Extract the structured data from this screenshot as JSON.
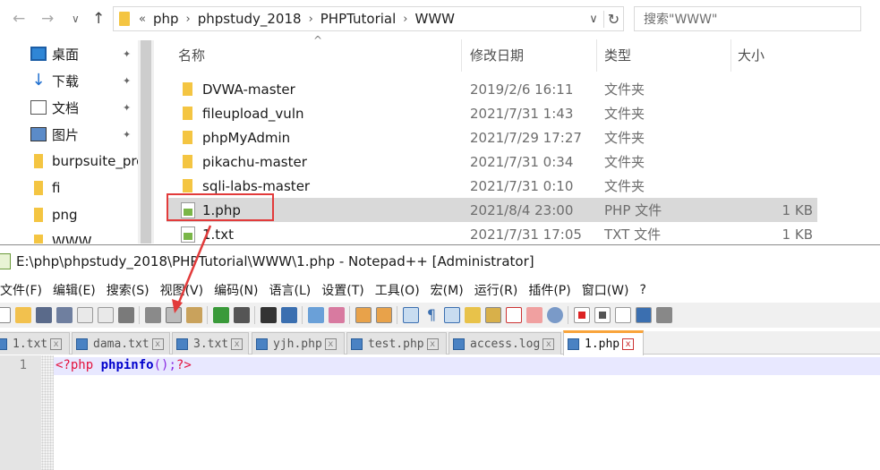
{
  "explorer": {
    "nav_back": "←",
    "nav_forward": "→",
    "nav_down": "∨",
    "nav_up": "↑",
    "address": {
      "overflow": "«",
      "crumbs": [
        "php",
        "phpstudy_2018",
        "PHPTutorial",
        "WWW"
      ],
      "dropdown": "∨",
      "refresh": "↻"
    },
    "search_placeholder": "搜索\"WWW\"",
    "sidebar": [
      {
        "label": "桌面",
        "icon": "desktop-icon",
        "pinned": true
      },
      {
        "label": "下载",
        "icon": "download-icon",
        "pinned": true
      },
      {
        "label": "文档",
        "icon": "document-icon",
        "pinned": true
      },
      {
        "label": "图片",
        "icon": "pictures-icon",
        "pinned": true
      },
      {
        "label": "burpsuite_pro",
        "icon": "folder-icon",
        "pinned": false
      },
      {
        "label": "fi",
        "icon": "folder-icon",
        "pinned": false
      },
      {
        "label": "png",
        "icon": "folder-icon",
        "pinned": false
      },
      {
        "label": "WWW",
        "icon": "folder-icon",
        "pinned": false
      }
    ],
    "pin_glyph": "📌",
    "columns": {
      "name": "名称",
      "date": "修改日期",
      "type": "类型",
      "size": "大小",
      "sort_glyph": "^"
    },
    "files": [
      {
        "name": "DVWA-master",
        "date": "2019/2/6 16:11",
        "type": "文件夹",
        "size": "",
        "kind": "folder",
        "selected": false
      },
      {
        "name": "fileupload_vuln",
        "date": "2021/7/31 1:43",
        "type": "文件夹",
        "size": "",
        "kind": "folder",
        "selected": false
      },
      {
        "name": "phpMyAdmin",
        "date": "2021/7/29 17:27",
        "type": "文件夹",
        "size": "",
        "kind": "folder",
        "selected": false
      },
      {
        "name": "pikachu-master",
        "date": "2021/7/31 0:34",
        "type": "文件夹",
        "size": "",
        "kind": "folder",
        "selected": false
      },
      {
        "name": "sqli-labs-master",
        "date": "2021/7/31 0:10",
        "type": "文件夹",
        "size": "",
        "kind": "folder",
        "selected": false
      },
      {
        "name": "1.php",
        "date": "2021/8/4 23:00",
        "type": "PHP 文件",
        "size": "1 KB",
        "kind": "file",
        "selected": true
      },
      {
        "name": "1.txt",
        "date": "2021/7/31 17:05",
        "type": "TXT 文件",
        "size": "1 KB",
        "kind": "file",
        "selected": false
      }
    ]
  },
  "notepad": {
    "title": "E:\\php\\phpstudy_2018\\PHPTutorial\\WWW\\1.php - Notepad++ [Administrator]",
    "menu": [
      "文件(F)",
      "编辑(E)",
      "搜索(S)",
      "视图(V)",
      "编码(N)",
      "语言(L)",
      "设置(T)",
      "工具(O)",
      "宏(M)",
      "运行(R)",
      "插件(P)",
      "窗口(W)",
      "?"
    ],
    "tabs": [
      {
        "label": "1.txt",
        "active": false
      },
      {
        "label": "dama.txt",
        "active": false
      },
      {
        "label": "3.txt",
        "active": false
      },
      {
        "label": "yjh.php",
        "active": false
      },
      {
        "label": "test.php",
        "active": false
      },
      {
        "label": "access.log",
        "active": false
      },
      {
        "label": "1.php",
        "active": true
      }
    ],
    "tab_close_glyph": "x",
    "line_number": "1",
    "code": {
      "open_tag": "<?php",
      "function": "phpinfo",
      "call": "();",
      "close_tag": "?>"
    }
  },
  "colors": {
    "highlight_box": "#e23b3b",
    "active_tab_accent": "#f9a43b",
    "php_tag": "#e3123d",
    "php_function": "#0000cc"
  }
}
